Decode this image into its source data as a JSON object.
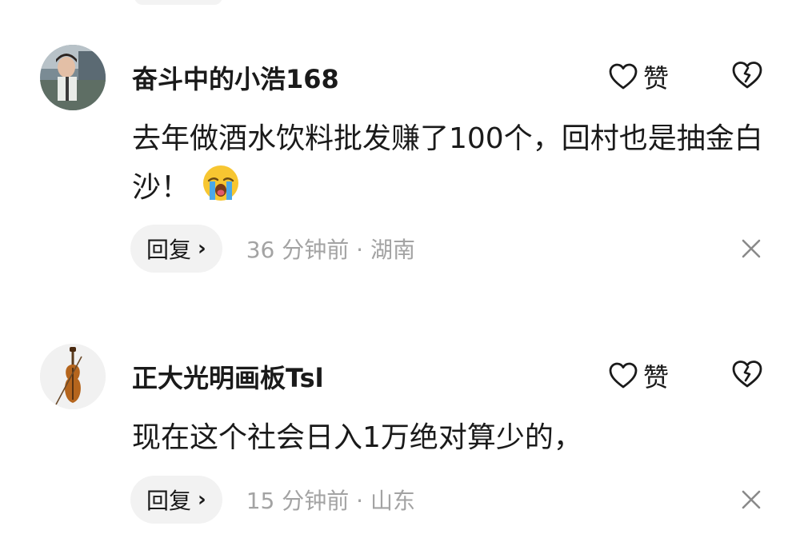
{
  "comments": [
    {
      "username": "奋斗中的小浩168",
      "like_label": "赞",
      "text": "去年做酒水饮料批发赚了100个，回村也是抽金白沙！",
      "emoji": "loudly-crying-face",
      "reply_label": "回复",
      "time": "36 分钟前",
      "separator": "·",
      "location": "湖南",
      "avatar": "person-photo-avatar"
    },
    {
      "username": "正大光明画板Tsl",
      "like_label": "赞",
      "text": "现在这个社会日入1万绝对算少的，",
      "reply_label": "回复",
      "time": "15 分钟前",
      "separator": "·",
      "location": "山东",
      "avatar": "violin-avatar"
    }
  ],
  "colors": {
    "text": "#1a1a1a",
    "meta": "#a3a3a3",
    "reply_bg": "#f2f2f2",
    "close": "#8a8a8a"
  }
}
